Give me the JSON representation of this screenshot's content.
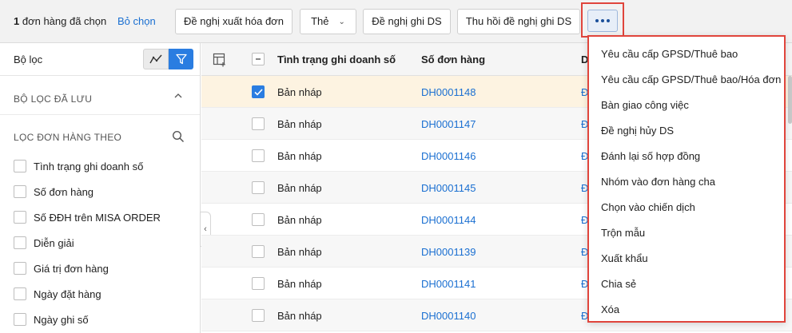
{
  "toolbar": {
    "selected_count": "1",
    "selected_text": "đơn hàng đã chọn",
    "unselect_label": "Bỏ chọn",
    "buttons": {
      "invoice": "Đề nghị xuất hóa đơn",
      "tag": "Thẻ",
      "propose_ds": "Đề nghị ghi DS",
      "revoke_ds": "Thu hồi đề nghị ghi DS"
    },
    "more_icon": "more-horizontal-icon"
  },
  "filter_panel": {
    "title": "Bộ lọc",
    "saved_section": "BỘ LỌC ĐÃ LƯU",
    "filter_by": "LỌC ĐƠN HÀNG THEO",
    "items": [
      "Tình trạng ghi doanh số",
      "Số đơn hàng",
      "Số ĐĐH trên MISA ORDER",
      "Diễn giải",
      "Giá trị đơn hàng",
      "Ngày đặt hàng",
      "Ngày ghi số"
    ],
    "accent_color": "#2a7de1"
  },
  "table": {
    "headers": {
      "status": "Tình trạng ghi doanh số",
      "order_no": "Số đơn hàng",
      "next": "D"
    },
    "rows": [
      {
        "status": "Bản nháp",
        "order_no": "DH0001148",
        "checked": true,
        "next": "Đ"
      },
      {
        "status": "Bản nháp",
        "order_no": "DH0001147",
        "checked": false,
        "next": "Đ"
      },
      {
        "status": "Bản nháp",
        "order_no": "DH0001146",
        "checked": false,
        "next": "Đ"
      },
      {
        "status": "Bản nháp",
        "order_no": "DH0001145",
        "checked": false,
        "next": "Đ"
      },
      {
        "status": "Bản nháp",
        "order_no": "DH0001144",
        "checked": false,
        "next": "Đ"
      },
      {
        "status": "Bản nháp",
        "order_no": "DH0001139",
        "checked": false,
        "next": "Đ"
      },
      {
        "status": "Bản nháp",
        "order_no": "DH0001141",
        "checked": false,
        "next": "Đ"
      },
      {
        "status": "Bản nháp",
        "order_no": "DH0001140",
        "checked": false,
        "next": "Đ"
      }
    ]
  },
  "more_menu": {
    "items": [
      "Yêu cầu cấp GPSD/Thuê bao",
      "Yêu cầu cấp GPSD/Thuê bao/Hóa đơn",
      "Bàn giao công việc",
      "Đề nghị hủy DS",
      "Đánh lại số hợp đồng",
      "Nhóm vào đơn hàng cha",
      "Chọn vào chiến dịch",
      "Trộn mẫu",
      "Xuất khẩu",
      "Chia sẻ",
      "Xóa"
    ],
    "highlight_color": "#e0453c"
  }
}
